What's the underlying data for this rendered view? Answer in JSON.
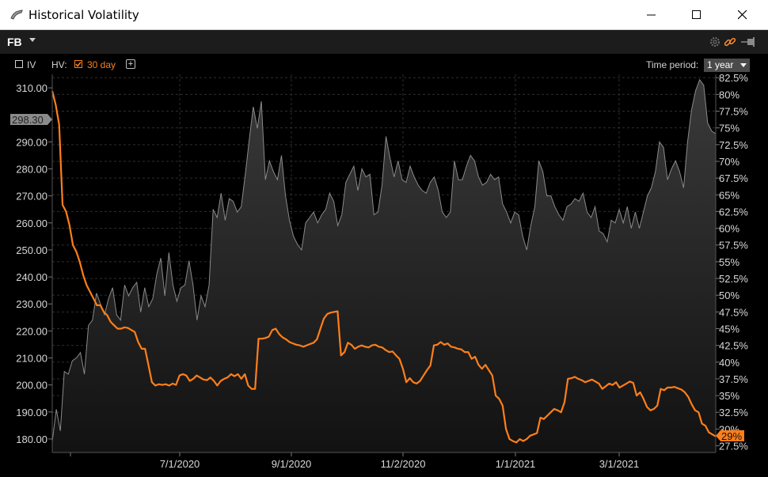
{
  "window": {
    "title": "Historical Volatility"
  },
  "toolbar": {
    "ticker": "FB"
  },
  "options": {
    "iv_label": "IV",
    "hv_label": "HV:",
    "hv_series_label": "30 day",
    "add_label": "+",
    "time_period_label": "Time period:",
    "time_period_value": "1 year"
  },
  "colors": {
    "price": "#8a8a8a",
    "volatility": "#ff7f1a",
    "background": "#000000"
  },
  "chart_data": {
    "type": "line",
    "x_tick_labels": [
      "7/1/2020",
      "9/1/2020",
      "11/2/2020",
      "1/1/2021",
      "3/1/2021"
    ],
    "left_axis": {
      "tick_labels": [
        "180.00",
        "190.00",
        "200.00",
        "210.00",
        "220.00",
        "230.00",
        "240.00",
        "250.00",
        "260.00",
        "270.00",
        "280.00",
        "290.00",
        "298.30",
        "310.00"
      ],
      "ylim": [
        175,
        315
      ]
    },
    "right_axis": {
      "tick_labels": [
        "27.5%",
        "30%",
        "32.5%",
        "35%",
        "37.5%",
        "40%",
        "42.5%",
        "45%",
        "47.5%",
        "50%",
        "52.5%",
        "55%",
        "57.5%",
        "60%",
        "62.5%",
        "65%",
        "67.5%",
        "70%",
        "72.5%",
        "75%",
        "77.5%",
        "80%",
        "82.5%"
      ],
      "ylim": [
        26.5,
        83
      ]
    },
    "last_price_label": "298.30",
    "last_volatility_label": "29%",
    "series": [
      {
        "name": "Price",
        "axis": "left",
        "values": [
          179,
          191,
          183,
          205,
          204,
          209,
          210,
          212,
          204,
          222,
          224,
          234,
          230,
          226,
          232,
          236,
          226,
          224,
          237,
          233,
          236,
          238,
          227,
          236,
          229,
          232,
          241,
          247,
          233,
          249,
          237,
          231,
          236,
          237,
          246,
          237,
          224,
          233,
          229,
          237,
          265,
          262,
          271,
          261,
          269,
          268,
          264,
          266,
          278,
          291,
          303,
          295,
          305,
          276,
          283,
          279,
          276,
          285,
          270,
          261,
          255,
          252,
          250,
          260,
          262,
          264,
          260,
          263,
          265,
          271,
          268,
          259,
          263,
          275,
          278,
          281,
          272,
          280,
          277,
          278,
          263,
          264,
          274,
          292,
          284,
          277,
          283,
          276,
          275,
          281,
          277,
          274,
          272,
          271,
          275,
          277,
          272,
          264,
          262,
          264,
          283,
          276,
          276,
          281,
          285,
          283,
          277,
          274,
          275,
          278,
          276,
          277,
          267,
          264,
          260,
          264,
          263,
          255,
          250,
          259,
          266,
          283,
          279,
          270,
          270,
          266,
          263,
          261,
          266,
          267,
          269,
          268,
          271,
          264,
          262,
          266,
          257,
          256,
          253,
          261,
          260,
          265,
          260,
          266,
          258,
          264,
          258,
          264,
          270,
          273,
          279,
          290,
          288,
          276,
          280,
          283,
          279,
          273,
          290,
          302,
          309,
          313,
          311,
          297,
          294,
          293
        ],
        "x_range": [
          0,
          170
        ]
      },
      {
        "name": "30 day",
        "axis": "right",
        "values": [
          80.5,
          78.5,
          75.5,
          63.5,
          62.5,
          60.5,
          57.5,
          56.5,
          55,
          53,
          51.5,
          50.5,
          49.5,
          48.5,
          48.5,
          47.5,
          47,
          46,
          45.5,
          45,
          45,
          45.2,
          45.1,
          44.8,
          44.5,
          43,
          42,
          42,
          39.5,
          37,
          36.5,
          36.7,
          36.6,
          36.7,
          36.5,
          36.8,
          36.6,
          38,
          38.2,
          38,
          37.2,
          37.5,
          38,
          37.7,
          37.4,
          37.3,
          37.7,
          37.2,
          36.5,
          37.2,
          37.5,
          37.7,
          38.2,
          37.9,
          38.2,
          37.5,
          38.2,
          36.5,
          36,
          36,
          43.5,
          43.5,
          43.6,
          43.8,
          44.8,
          45,
          44.2,
          43.7,
          43.4,
          43,
          42.8,
          42.6,
          42.5,
          42.3,
          42.5,
          42.7,
          42.9,
          43.4,
          45,
          46.5,
          47.2,
          47.4,
          47.5,
          47.6,
          41,
          41.5,
          42.9,
          42.6,
          42,
          42.3,
          42.5,
          42.3,
          42.2,
          42.5,
          42.6,
          42.3,
          42.2,
          41.8,
          41.5,
          41.6,
          41,
          40.5,
          39,
          37,
          37.6,
          37,
          36.8,
          37.2,
          38,
          38.8,
          39.5,
          42.5,
          42.6,
          43,
          42.6,
          42.8,
          42.3,
          42.2,
          42,
          41.9,
          41.5,
          41.5,
          40.5,
          40.8,
          39.6,
          39,
          39.6,
          38.8,
          38,
          35,
          34.5,
          33.5,
          30,
          28.5,
          28.2,
          28,
          28.5,
          28.2,
          28.5,
          29,
          29.2,
          29.4,
          31.7,
          31.5,
          32,
          32.5,
          33,
          32.8,
          32.5,
          34,
          37.5,
          37.6,
          37.8,
          37.5,
          37.3,
          37,
          37.2,
          37.4,
          37.1,
          36.8,
          36,
          36.4,
          36.8,
          36.6,
          37,
          36.2,
          36.5,
          36.8,
          37.1,
          36.9,
          35,
          35.5,
          34.5,
          33.3,
          32.8,
          33,
          33.5,
          36,
          35.8,
          36.2,
          36.2,
          36.3,
          36.1,
          35.9,
          35.5,
          34.8,
          33.7,
          32.8,
          32.5,
          30.8,
          30.5,
          29.5,
          29.2,
          28.9
        ],
        "x_range": [
          0,
          170
        ]
      }
    ]
  }
}
